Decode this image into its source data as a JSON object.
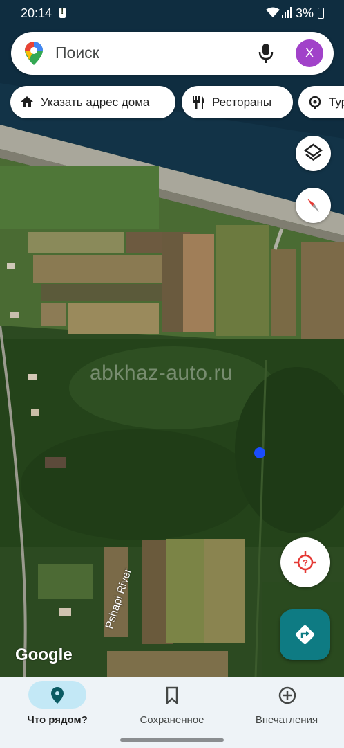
{
  "status_bar": {
    "time": "20:14",
    "battery": "3%"
  },
  "search": {
    "placeholder": "Поиск",
    "avatar_letter": "Х"
  },
  "chips": [
    {
      "label": "Указать адрес дома",
      "icon": "home-icon"
    },
    {
      "label": "Рестораны",
      "icon": "restaurant-icon"
    },
    {
      "label": "Тур",
      "icon": "attraction-icon"
    }
  ],
  "map": {
    "watermark": "abkhaz-auto.ru",
    "attribution": "Google",
    "river_label": "Pshapi River",
    "controls": [
      "layers-icon",
      "compass-icon",
      "location-icon",
      "directions-icon"
    ]
  },
  "bottom_nav": [
    {
      "label": "Что рядом?",
      "icon": "explore-pin-icon",
      "active": true
    },
    {
      "label": "Сохраненное",
      "icon": "bookmark-icon",
      "active": false
    },
    {
      "label": "Впечатления",
      "icon": "contribute-icon",
      "active": false
    }
  ],
  "colors": {
    "accent": "#0e7b83",
    "avatar": "#a142c9",
    "nav_active": "#c3e8f6",
    "location_dot": "#1a4cff"
  }
}
